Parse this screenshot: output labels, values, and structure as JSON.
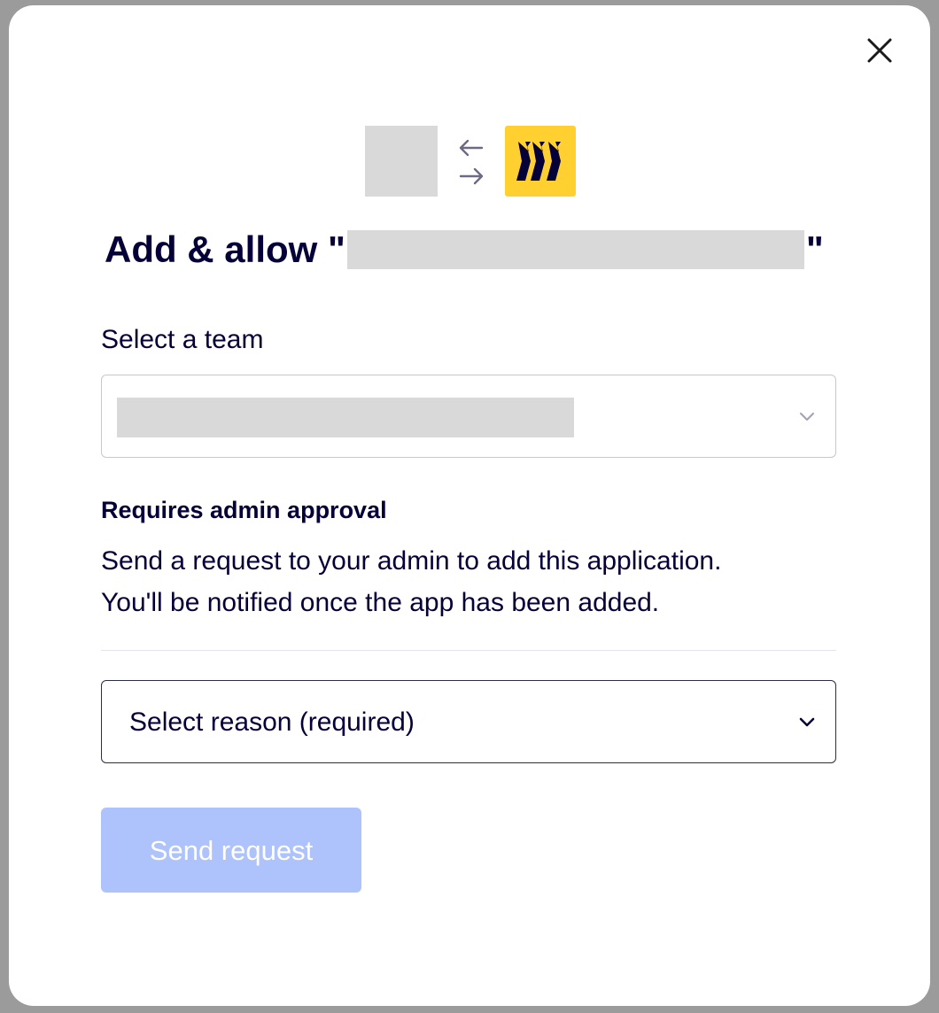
{
  "dialog": {
    "close_icon": "close-icon",
    "swap_icon": "swap-arrows-icon",
    "brand_color": "#ffd02f",
    "title_prefix": "Add & allow \"",
    "title_suffix": "\""
  },
  "team_select": {
    "label": "Select a team",
    "icon": "chevron-down-icon"
  },
  "admin_notice": {
    "heading": "Requires admin approval",
    "line1": "Send a request to your admin to add this application.",
    "line2": "You'll be notified once the app has been added."
  },
  "reason_select": {
    "selected": "Select reason (required)",
    "icon": "chevron-down-icon"
  },
  "send_button": {
    "label": "Send request",
    "color": "#aec2fc",
    "disabled": true
  }
}
